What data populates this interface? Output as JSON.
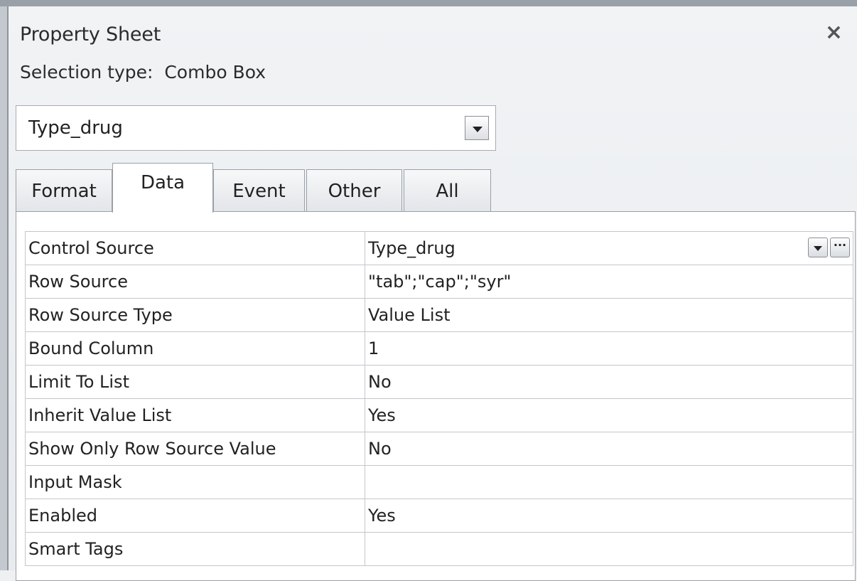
{
  "panel": {
    "title": "Property Sheet",
    "close_label": "×",
    "selection_type_label": "Selection type:",
    "selection_type_value": "Combo Box"
  },
  "object_selector": {
    "value": "Type_drug"
  },
  "tabs": [
    {
      "label": "Format",
      "active": false
    },
    {
      "label": "Data",
      "active": true
    },
    {
      "label": "Event",
      "active": false
    },
    {
      "label": "Other",
      "active": false
    },
    {
      "label": "All",
      "active": false
    }
  ],
  "properties": [
    {
      "name": "Control Source",
      "value": "Type_drug"
    },
    {
      "name": "Row Source",
      "value": "\"tab\";\"cap\";\"syr\""
    },
    {
      "name": "Row Source Type",
      "value": "Value List"
    },
    {
      "name": "Bound Column",
      "value": "1"
    },
    {
      "name": "Limit To List",
      "value": "No"
    },
    {
      "name": "Inherit Value List",
      "value": "Yes"
    },
    {
      "name": "Show Only Row Source Value",
      "value": "No"
    },
    {
      "name": "Input Mask",
      "value": ""
    },
    {
      "name": "Enabled",
      "value": "Yes"
    },
    {
      "name": "Smart Tags",
      "value": ""
    }
  ],
  "row_buttons": {
    "build_label": "···"
  }
}
